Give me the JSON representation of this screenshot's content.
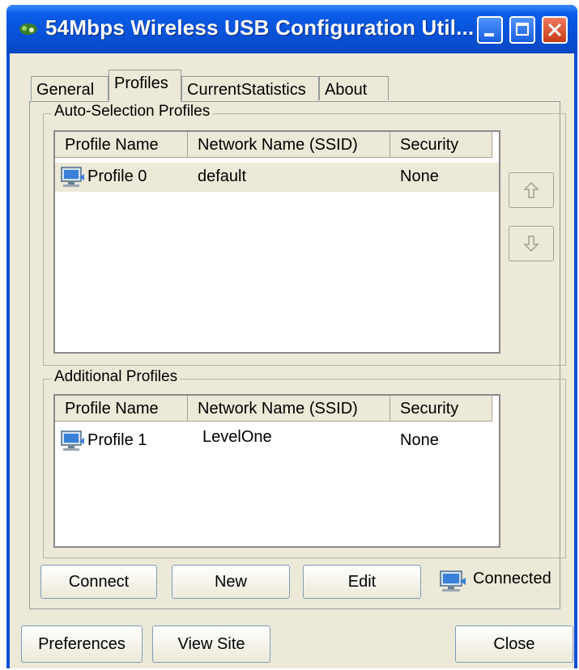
{
  "window": {
    "title": "54Mbps Wireless USB Configuration Util..."
  },
  "tabs": [
    {
      "label": "General",
      "active": false
    },
    {
      "label": "Profiles",
      "active": true
    },
    {
      "label": "CurrentStatistics",
      "active": false
    },
    {
      "label": "About",
      "active": false
    }
  ],
  "auto_selection": {
    "label": "Auto-Selection Profiles",
    "columns": [
      "Profile Name",
      "Network Name (SSID)",
      "Security"
    ],
    "rows": [
      {
        "profile": "Profile 0",
        "ssid": "default",
        "security": "None",
        "selected": true
      }
    ],
    "move_up_icon": "arrow-up-icon",
    "move_down_icon": "arrow-down-icon"
  },
  "additional": {
    "label": "Additional Profiles",
    "columns": [
      "Profile Name",
      "Network Name (SSID)",
      "Security"
    ],
    "rows": [
      {
        "profile": "Profile 1",
        "ssid": "LevelOne",
        "security": "None",
        "selected": false
      }
    ]
  },
  "actions": {
    "connect": "Connect",
    "new": "New",
    "edit": "Edit",
    "status": "Connected"
  },
  "footer": {
    "preferences": "Preferences",
    "view_site": "View Site",
    "close": "Close"
  },
  "colors": {
    "titlebar": "#0a52d8",
    "face": "#ece9d8",
    "close_button": "#d9552e"
  }
}
